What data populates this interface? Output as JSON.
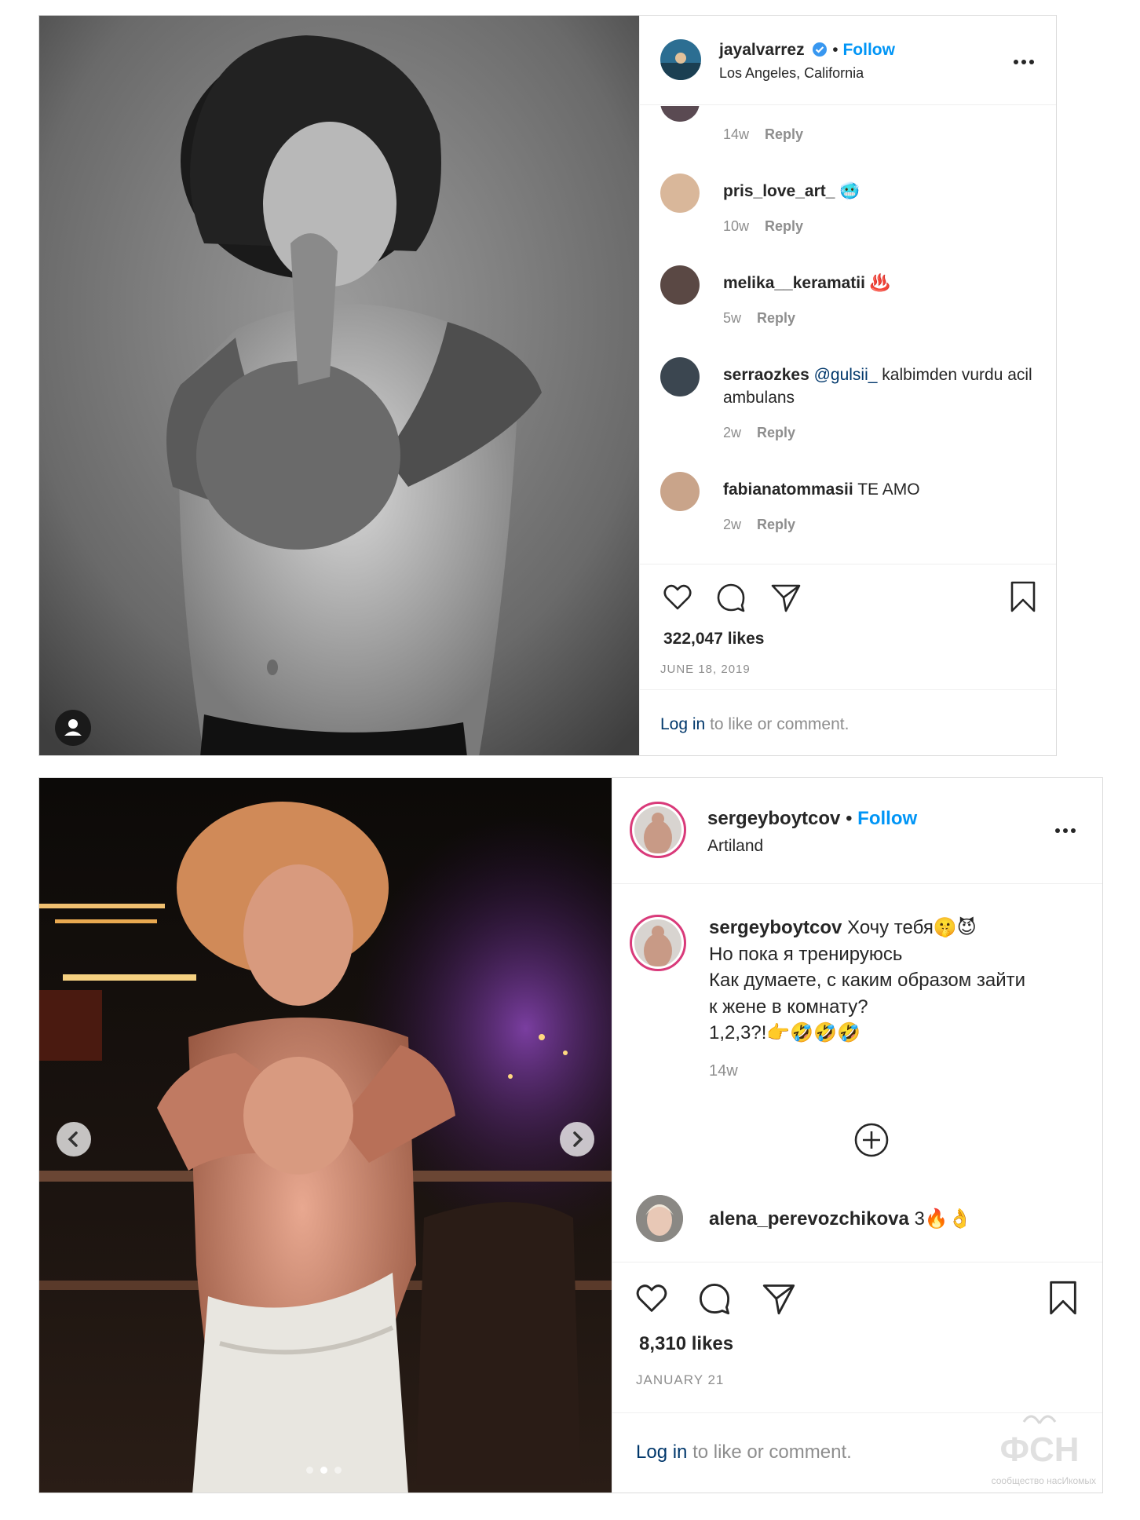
{
  "post1": {
    "username": "jayalvarrez",
    "separator": "•",
    "follow_label": "Follow",
    "location": "Los Angeles, California",
    "comments": [
      {
        "username": "",
        "text": "",
        "emoji": "",
        "time": "14w",
        "reply": "Reply"
      },
      {
        "username": "pris_love_art_",
        "text": "",
        "emoji": "🥶",
        "time": "10w",
        "reply": "Reply"
      },
      {
        "username": "melika__keramatii",
        "text": "",
        "emoji": "♨️",
        "time": "5w",
        "reply": "Reply"
      },
      {
        "username": "serraozkes",
        "mention": "@gulsii_",
        "text": "kalbimden vurdu acil ambulans",
        "time": "2w",
        "reply": "Reply"
      },
      {
        "username": "fabianatommasii",
        "text": "TE AMO",
        "time": "2w",
        "reply": "Reply"
      }
    ],
    "likes": "322,047 likes",
    "date": "JUNE 18, 2019",
    "login_link": "Log in",
    "login_rest": "to like or comment."
  },
  "post2": {
    "username": "sergeyboytcov",
    "separator": "•",
    "follow_label": "Follow",
    "location": "Artiland",
    "caption": {
      "username": "sergeyboytcov",
      "line1": "Хочу тебя🤫😈",
      "line2": "Но пока я тренируюсь",
      "line3": "Как думаете, с каким образом зайти",
      "line4": "к жене в комнату?",
      "line5": "1,2,3?!👉🤣🤣🤣",
      "time": "14w"
    },
    "comment": {
      "username": "alena_perevozchikova",
      "text": "3🔥👌"
    },
    "likes": "8,310 likes",
    "date": "JANUARY 21",
    "login_link": "Log in",
    "login_rest": "to like or comment.",
    "carousel": {
      "current": 2,
      "total": 3
    }
  },
  "watermark": {
    "logo": "ФСН",
    "text": "сообщество насИкомых"
  },
  "colors": {
    "follow": "#0095f6",
    "muted": "#8e8e8e",
    "link": "#00376b",
    "border": "#dbdbdb"
  },
  "icons": [
    "heart-icon",
    "comment-icon",
    "share-icon",
    "bookmark-icon",
    "more-icon",
    "plus-circle-icon",
    "verified-badge-icon",
    "user-icon",
    "chevron-left-icon",
    "chevron-right-icon"
  ]
}
